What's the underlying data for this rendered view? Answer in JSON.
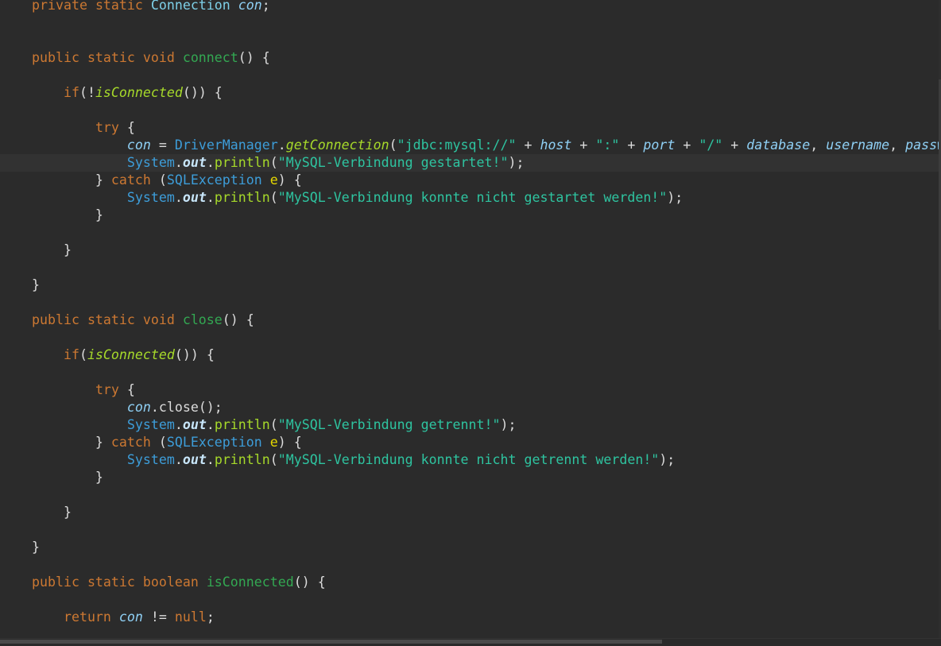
{
  "editor": {
    "current_line": 9,
    "lines": [
      [
        [
          "k",
          "private "
        ],
        [
          "k",
          "static "
        ],
        [
          "ty",
          "Connection "
        ],
        [
          "f",
          "con"
        ],
        [
          "p",
          ";"
        ]
      ],
      [],
      [],
      [
        [
          "k",
          "public "
        ],
        [
          "k",
          "static "
        ],
        [
          "k",
          "void "
        ],
        [
          "m",
          "connect"
        ],
        [
          "p",
          "() {"
        ]
      ],
      [],
      [
        [
          "p",
          "    "
        ],
        [
          "k",
          "if"
        ],
        [
          "p",
          "(!"
        ],
        [
          "ci",
          "isConnected"
        ],
        [
          "p",
          "()) {"
        ]
      ],
      [],
      [
        [
          "p",
          "        "
        ],
        [
          "k",
          "try "
        ],
        [
          "p",
          "{"
        ]
      ],
      [
        [
          "p",
          "            "
        ],
        [
          "f",
          "con"
        ],
        [
          "p",
          " = "
        ],
        [
          "t",
          "DriverManager"
        ],
        [
          "p",
          "."
        ],
        [
          "ci",
          "getConnection"
        ],
        [
          "p",
          "("
        ],
        [
          "s",
          "\"jdbc:mysql://\""
        ],
        [
          "p",
          " + "
        ],
        [
          "f",
          "host"
        ],
        [
          "p",
          " + "
        ],
        [
          "s",
          "\":\""
        ],
        [
          "p",
          " + "
        ],
        [
          "f",
          "port"
        ],
        [
          "p",
          " + "
        ],
        [
          "s",
          "\"/\""
        ],
        [
          "p",
          " + "
        ],
        [
          "f",
          "database"
        ],
        [
          "p",
          ", "
        ],
        [
          "f",
          "username"
        ],
        [
          "p",
          ", "
        ],
        [
          "f",
          "password"
        ],
        [
          "p",
          ");"
        ]
      ],
      [
        [
          "p",
          "            "
        ],
        [
          "t",
          "System"
        ],
        [
          "p",
          "."
        ],
        [
          "o",
          "out"
        ],
        [
          "p",
          "."
        ],
        [
          "c",
          "println"
        ],
        [
          "p",
          "("
        ],
        [
          "s",
          "\"MySQL-Verbindung gestartet!\""
        ],
        [
          "p",
          ");"
        ]
      ],
      [
        [
          "p",
          "        } "
        ],
        [
          "k",
          "catch "
        ],
        [
          "p",
          "("
        ],
        [
          "t",
          "SQLException "
        ],
        [
          "v",
          "e"
        ],
        [
          "p",
          ") {"
        ]
      ],
      [
        [
          "p",
          "            "
        ],
        [
          "t",
          "System"
        ],
        [
          "p",
          "."
        ],
        [
          "o",
          "out"
        ],
        [
          "p",
          "."
        ],
        [
          "c",
          "println"
        ],
        [
          "p",
          "("
        ],
        [
          "s",
          "\"MySQL-Verbindung konnte nicht gestartet werden!\""
        ],
        [
          "p",
          ");"
        ]
      ],
      [
        [
          "p",
          "        }"
        ]
      ],
      [],
      [
        [
          "p",
          "    }"
        ]
      ],
      [],
      [
        [
          "p",
          "}"
        ]
      ],
      [],
      [
        [
          "k",
          "public "
        ],
        [
          "k",
          "static "
        ],
        [
          "k",
          "void "
        ],
        [
          "m",
          "close"
        ],
        [
          "p",
          "() {"
        ]
      ],
      [],
      [
        [
          "p",
          "    "
        ],
        [
          "k",
          "if"
        ],
        [
          "p",
          "("
        ],
        [
          "ci",
          "isConnected"
        ],
        [
          "p",
          "()) {"
        ]
      ],
      [],
      [
        [
          "p",
          "        "
        ],
        [
          "k",
          "try "
        ],
        [
          "p",
          "{"
        ]
      ],
      [
        [
          "p",
          "            "
        ],
        [
          "f",
          "con"
        ],
        [
          "p",
          ".close();"
        ]
      ],
      [
        [
          "p",
          "            "
        ],
        [
          "t",
          "System"
        ],
        [
          "p",
          "."
        ],
        [
          "o",
          "out"
        ],
        [
          "p",
          "."
        ],
        [
          "c",
          "println"
        ],
        [
          "p",
          "("
        ],
        [
          "s",
          "\"MySQL-Verbindung getrennt!\""
        ],
        [
          "p",
          ");"
        ]
      ],
      [
        [
          "p",
          "        } "
        ],
        [
          "k",
          "catch "
        ],
        [
          "p",
          "("
        ],
        [
          "t",
          "SQLException "
        ],
        [
          "v",
          "e"
        ],
        [
          "p",
          ") {"
        ]
      ],
      [
        [
          "p",
          "            "
        ],
        [
          "t",
          "System"
        ],
        [
          "p",
          "."
        ],
        [
          "o",
          "out"
        ],
        [
          "p",
          "."
        ],
        [
          "c",
          "println"
        ],
        [
          "p",
          "("
        ],
        [
          "s",
          "\"MySQL-Verbindung konnte nicht getrennt werden!\""
        ],
        [
          "p",
          ");"
        ]
      ],
      [
        [
          "p",
          "        }"
        ]
      ],
      [],
      [
        [
          "p",
          "    }"
        ]
      ],
      [],
      [
        [
          "p",
          "}"
        ]
      ],
      [],
      [
        [
          "k",
          "public "
        ],
        [
          "k",
          "static "
        ],
        [
          "k",
          "boolean "
        ],
        [
          "m",
          "isConnected"
        ],
        [
          "p",
          "() {"
        ]
      ],
      [],
      [
        [
          "p",
          "    "
        ],
        [
          "k",
          "return "
        ],
        [
          "f",
          "con"
        ],
        [
          "p",
          " != "
        ],
        [
          "k",
          "null"
        ],
        [
          "p",
          ";"
        ]
      ]
    ]
  }
}
